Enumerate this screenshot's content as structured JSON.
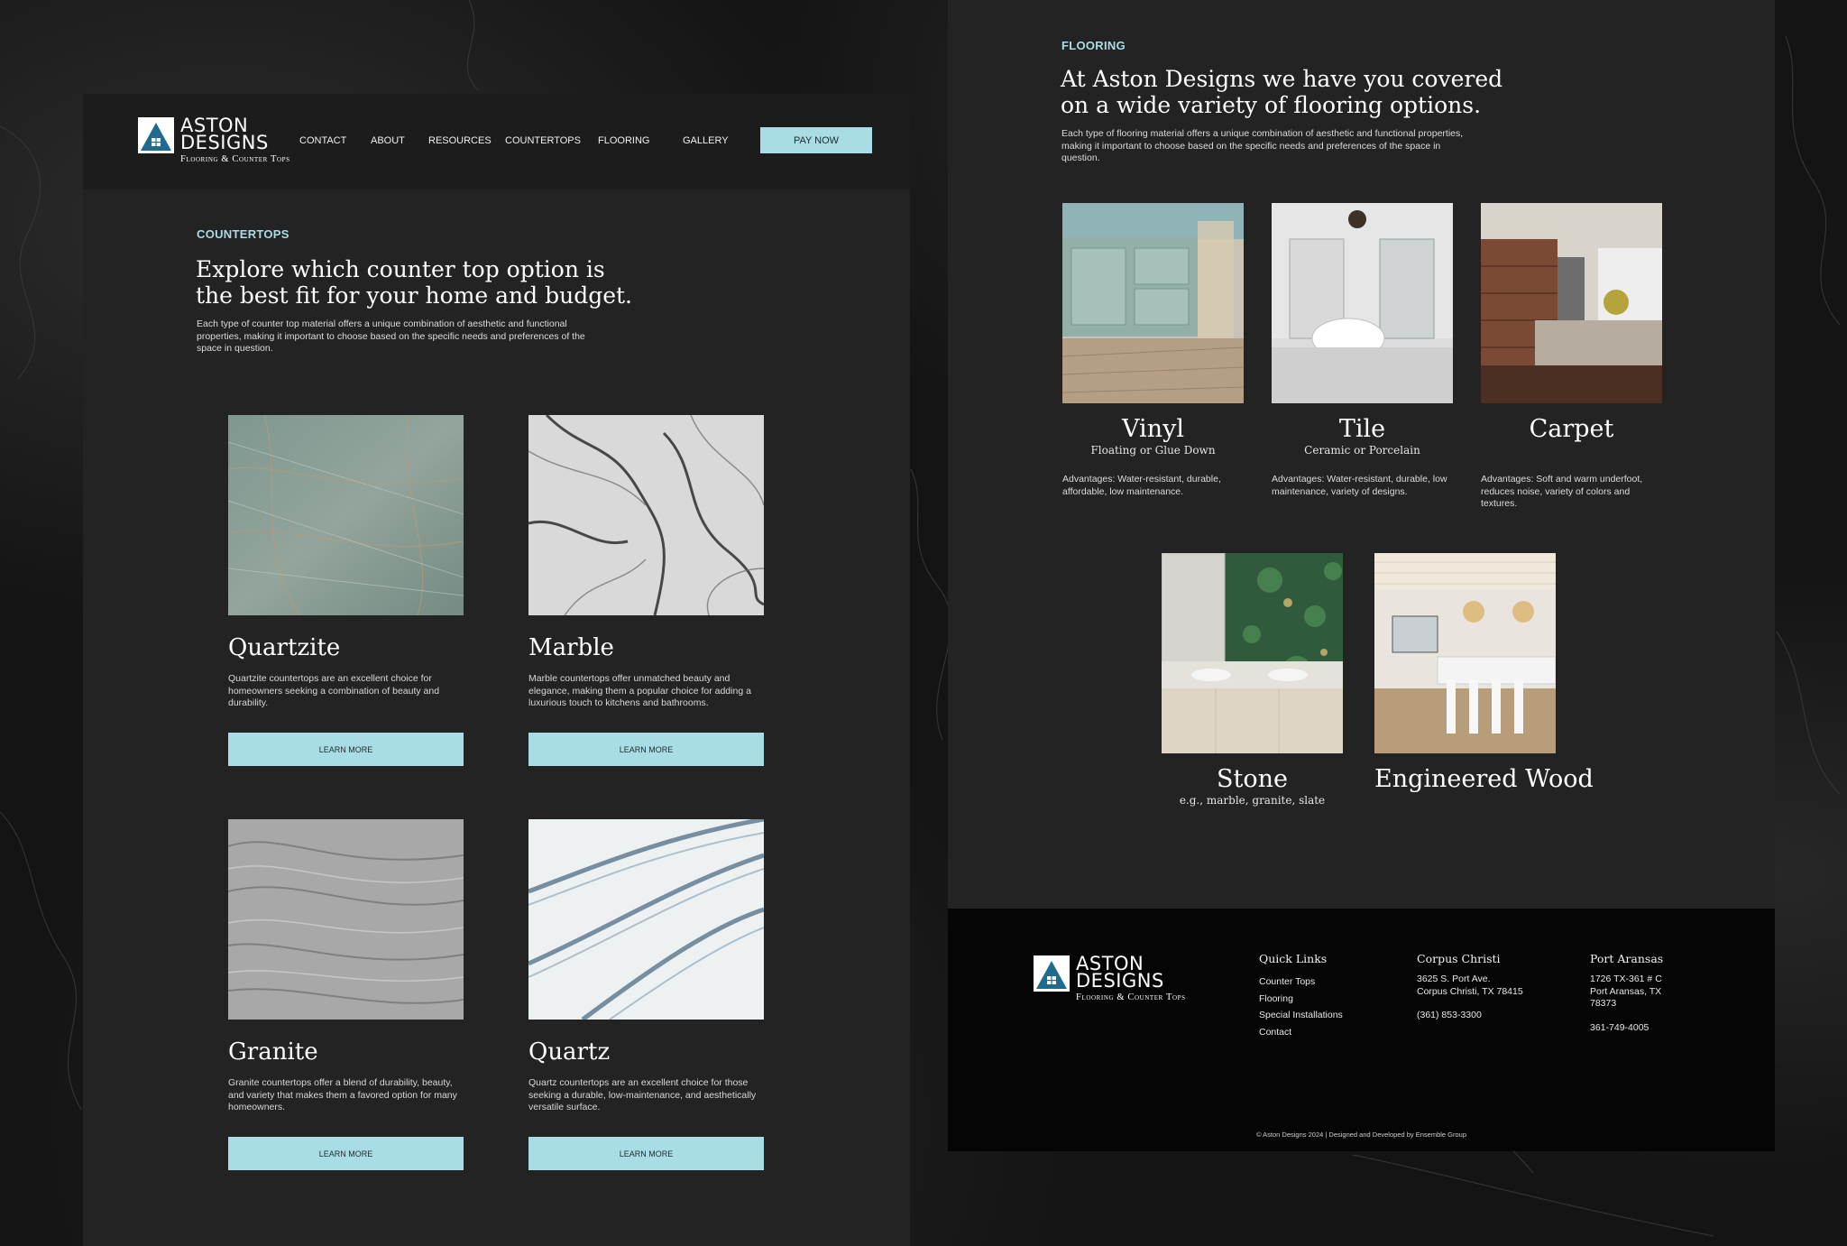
{
  "brand": {
    "name_line1": "ASTON",
    "name_line2": "DESIGNS",
    "tagline": "Flooring & Counter Tops",
    "accent": "#a9dde6",
    "logo_blue": "#1f6a8f"
  },
  "nav": {
    "items": [
      "CONTACT",
      "ABOUT",
      "RESOURCES",
      "COUNTERTOPS",
      "FLOORING",
      "GALLERY"
    ],
    "cta": "PAY NOW"
  },
  "countertops": {
    "label": "COUNTERTOPS",
    "headline_line1": "Explore which counter top option is",
    "headline_line2": "the best fit for your home and budget.",
    "intro": "Each type of counter top material offers a unique combination of aesthetic and functional properties, making it important to choose based on the specific needs and preferences of the space in question.",
    "cards": [
      {
        "name": "Quartzite",
        "description": "Quartzite countertops are an excellent choice for homeowners seeking a combination of beauty and durability.",
        "button": "LEARN MORE"
      },
      {
        "name": "Marble",
        "description": "Marble countertops offer unmatched beauty and elegance, making them a popular choice for adding a luxurious touch to kitchens and bathrooms.",
        "button": "LEARN MORE"
      },
      {
        "name": "Granite",
        "description": "Granite countertops offer a blend of durability, beauty, and variety that makes them a favored option for many homeowners.",
        "button": "LEARN MORE"
      },
      {
        "name": "Quartz",
        "description": "Quartz countertops are an excellent choice for those seeking a durable, low-maintenance, and aesthetically versatile surface.",
        "button": "LEARN MORE"
      }
    ]
  },
  "flooring": {
    "label": "FLOORING",
    "headline_line1": "At Aston Designs we have you covered",
    "headline_line2": "on a wide variety of flooring options.",
    "intro": "Each type of flooring material offers a unique combination of aesthetic and functional properties, making it important to choose based on the specific needs and preferences of the space in question.",
    "cards": [
      {
        "name": "Vinyl",
        "subtitle": "Floating or Glue Down",
        "advantages": "Advantages: Water-resistant, durable, affordable, low maintenance."
      },
      {
        "name": "Tile",
        "subtitle": "Ceramic or Porcelain",
        "advantages": "Advantages: Water-resistant, durable, low maintenance, variety of designs."
      },
      {
        "name": "Carpet",
        "subtitle": "",
        "advantages": "Advantages: Soft and warm underfoot, reduces noise, variety of colors and textures."
      },
      {
        "name": "Stone",
        "subtitle": "e.g., marble, granite, slate",
        "advantages": ""
      },
      {
        "name": "Engineered Wood",
        "subtitle": "",
        "advantages": ""
      }
    ]
  },
  "footer": {
    "quick_links_title": "Quick Links",
    "quick_links": [
      "Counter Tops",
      "Flooring",
      "Special Installations",
      "Contact"
    ],
    "corpus": {
      "title": "Corpus Christi",
      "address_line1": "3625 S. Port Ave.",
      "address_line2": "Corpus Christi, TX 78415",
      "phone": "(361) 853-3300"
    },
    "port": {
      "title": "Port Aransas",
      "address_line1": "1726 TX-361 # C",
      "address_line2": "Port Aransas, TX",
      "address_line3": "78373",
      "phone": "361-749-4005"
    },
    "copyright": "© Aston Designs 2024 | Designed and Developed by Ensemble Group"
  }
}
